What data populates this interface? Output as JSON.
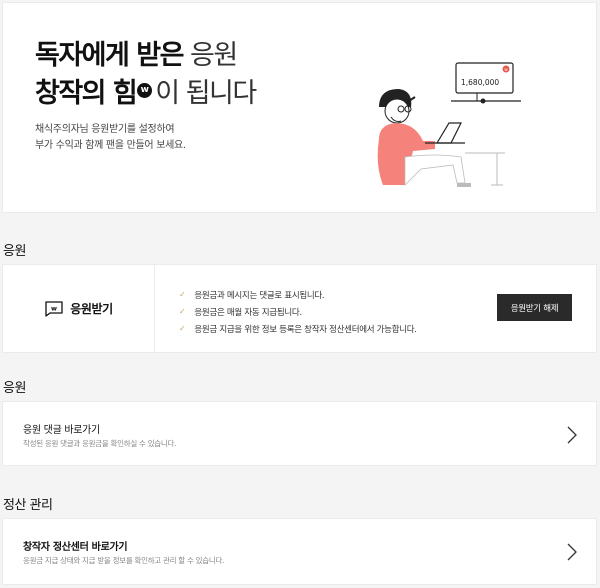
{
  "hero": {
    "line1_bold": "독자에게 받은",
    "line1_light": "응원",
    "line2_bold": "창작의 힘",
    "badge": "w",
    "line2_light": "이 됩니다",
    "sub_line1": "채식주의자님 응원받기를 설정하여",
    "sub_line2": "부가 수익과 함께 팬을 만들어 보세요.",
    "illustration_amount": "1,680,000",
    "illustration_badge": "w"
  },
  "sections": {
    "support_title": "응원",
    "comments_title": "응원",
    "settlement_title": "정산 관리"
  },
  "support_card": {
    "label": "응원받기",
    "bullets": [
      "응원금과 메시지는 댓글로 표시됩니다.",
      "응원금은 매월 자동 지급됩니다.",
      "응원금 지급을 위한 정보 등록은 창작자 정산센터에서 가능합니다."
    ],
    "cancel_button": "응원받기 해제"
  },
  "comments_card": {
    "title": "응원 댓글 바로가기",
    "desc": "작성된 응원 댓글과 응원금을 확인하실 수 있습니다."
  },
  "settlement_card": {
    "title": "창작자 정산센터 바로가기",
    "desc": "응원금 지급 상태와 지급 받을 정보를 확인하고 관리 할 수 있습니다."
  },
  "colors": {
    "accent_salmon": "#f5837b",
    "badge_red": "#e85a4f",
    "button_dark": "#2a2a2a",
    "check_gold": "#c9a46b"
  }
}
